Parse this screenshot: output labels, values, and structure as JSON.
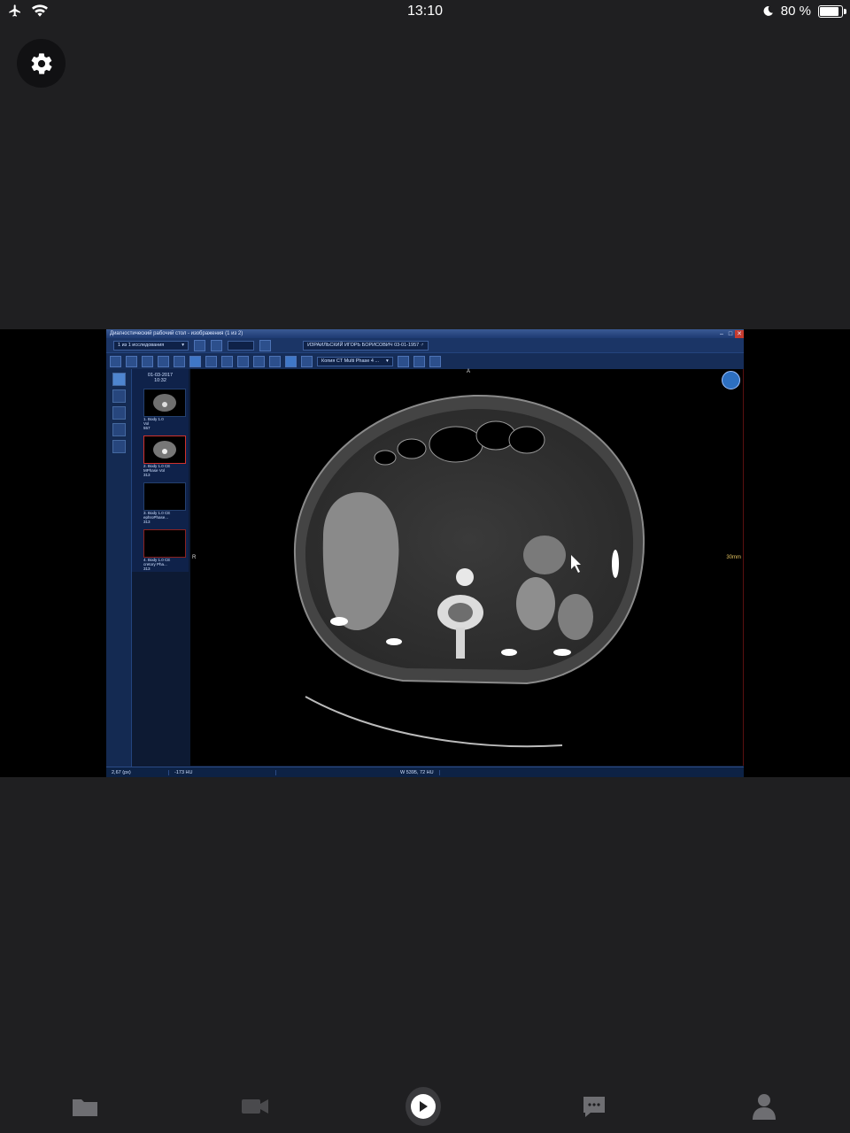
{
  "status_bar": {
    "time": "13:10",
    "battery_label": "80 %",
    "battery_level": 0.8,
    "icons": [
      "airplane-icon",
      "wifi-icon",
      "moon-icon",
      "battery-icon"
    ]
  },
  "settings": {
    "icon": "gear-icon"
  },
  "shared_screen": {
    "window_title": "Диагностический рабочий стол - изображения (1 из 2)",
    "study_selector": "1 из 1 исследования",
    "patient_label": "ИЗРАИЛЬСКИЙ ИГОРЬ БОРИСОВИЧ 03-01-1957 ♂",
    "series_selector": "Копия CT Multi Phase 4 ...",
    "study_date": "01-03-2017",
    "study_time": "10:32",
    "thumbnails": [
      {
        "line1": "1. Body 1.0",
        "line2": "Vol",
        "line3": "557"
      },
      {
        "line1": "2. Body 1.0 CE",
        "line2": "MPhase Vol",
        "line3": "313"
      },
      {
        "line1": "3. Body 1.0 CE",
        "line2": "ephroPhase...",
        "line3": "313"
      },
      {
        "line1": "4. Body 1.0 CE",
        "line2": "cretory Pha...",
        "line3": "313"
      }
    ],
    "orientation_top": "A",
    "orientation_left": "R",
    "scale_label": "30mm",
    "status": {
      "zoom": "2,67 (px)",
      "hu": "-173 HU",
      "window": "W 5395, 72 HU"
    },
    "accent_color": "#1b3566",
    "selection_color": "#d0312d"
  },
  "tab_bar": {
    "items": [
      "folder-icon",
      "video-icon",
      "play-icon",
      "chat-icon",
      "person-icon"
    ]
  }
}
